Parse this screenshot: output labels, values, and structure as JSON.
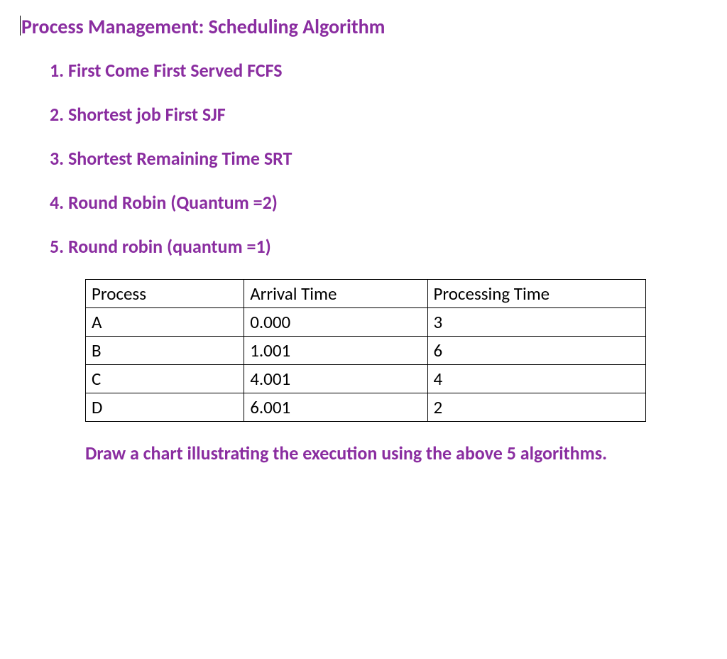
{
  "title": "Process Management: Scheduling Algorithm",
  "list": {
    "items": [
      {
        "num": "1.",
        "text": "First Come First Served    FCFS"
      },
      {
        "num": "2.",
        "text": "Shortest job First   SJF"
      },
      {
        "num": "3.",
        "text": "Shortest Remaining Time   SRT"
      },
      {
        "num": "4.",
        "text": "Round Robin (Quantum =2)"
      },
      {
        "num": "5.",
        "text": "Round robin (quantum =1)"
      }
    ]
  },
  "table": {
    "headers": {
      "c1": "Process",
      "c2": "Arrival Time",
      "c3": "Processing Time"
    },
    "rows": [
      {
        "c1": "A",
        "c2": "0.000",
        "c3": " 3"
      },
      {
        "c1": "B",
        "c2": "1.001",
        "c3": "6"
      },
      {
        "c1": "C",
        "c2": "4.001",
        "c3": "4"
      },
      {
        "c1": "D",
        "c2": "6.001",
        "c3": "2"
      }
    ]
  },
  "instruction": "Draw  a chart illustrating the execution using the above 5 algorithms."
}
